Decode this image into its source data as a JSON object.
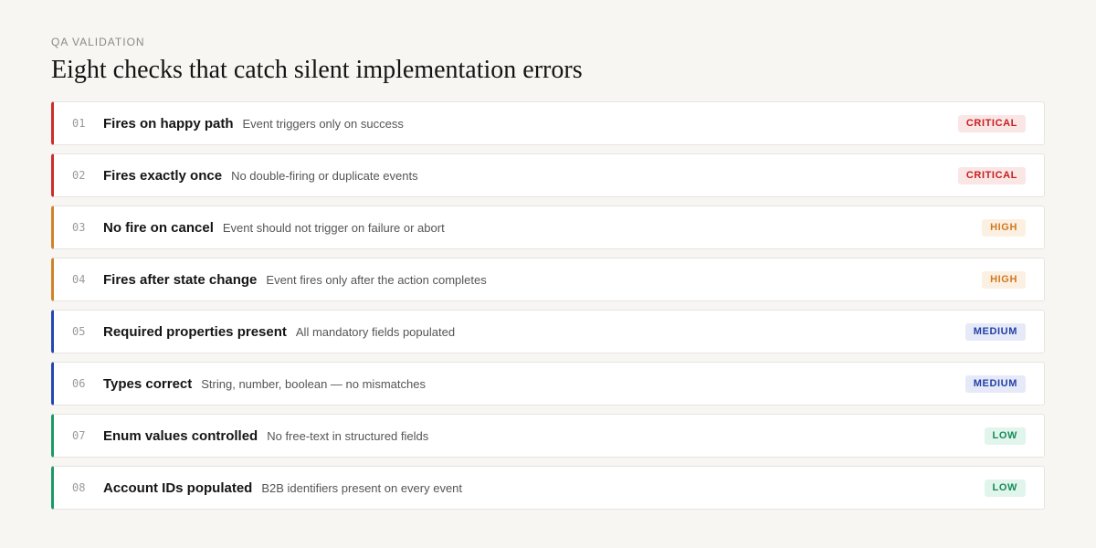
{
  "header": {
    "eyebrow": "QA VALIDATION",
    "title": "Eight checks that catch silent implementation errors"
  },
  "checks": [
    {
      "num": "01",
      "name": "Fires on happy path",
      "desc": "Event triggers only on success",
      "severity": "CRITICAL"
    },
    {
      "num": "02",
      "name": "Fires exactly once",
      "desc": "No double-firing or duplicate events",
      "severity": "CRITICAL"
    },
    {
      "num": "03",
      "name": "No fire on cancel",
      "desc": "Event should not trigger on failure or abort",
      "severity": "HIGH"
    },
    {
      "num": "04",
      "name": "Fires after state change",
      "desc": "Event fires only after the action completes",
      "severity": "HIGH"
    },
    {
      "num": "05",
      "name": "Required properties present",
      "desc": "All mandatory fields populated",
      "severity": "MEDIUM"
    },
    {
      "num": "06",
      "name": "Types correct",
      "desc": "String, number, boolean — no mismatches",
      "severity": "MEDIUM"
    },
    {
      "num": "07",
      "name": "Enum values controlled",
      "desc": "No free-text in structured fields",
      "severity": "LOW"
    },
    {
      "num": "08",
      "name": "Account IDs populated",
      "desc": "B2B identifiers present on every event",
      "severity": "LOW"
    }
  ],
  "severity_colors": {
    "CRITICAL": "#cc2b2b",
    "HIGH": "#d0822a",
    "MEDIUM": "#2446b0",
    "LOW": "#1b9a68"
  }
}
